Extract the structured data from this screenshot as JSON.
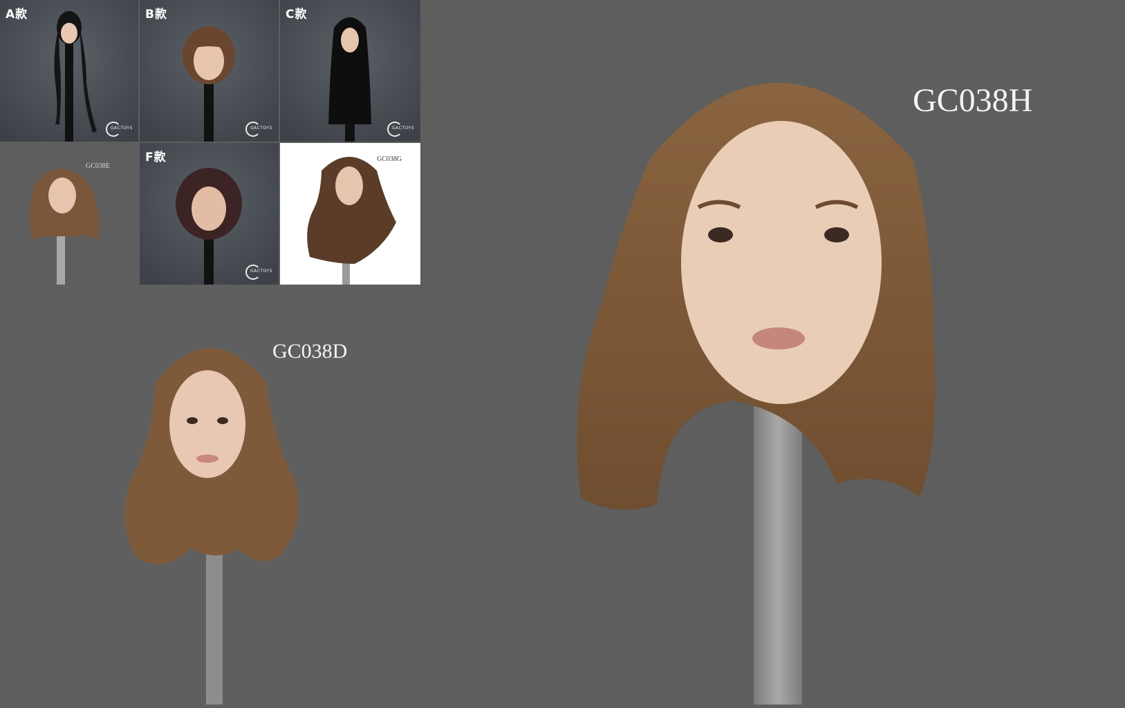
{
  "grid": {
    "tiles": [
      {
        "label": "A款"
      },
      {
        "label": "B款"
      },
      {
        "label": "C款"
      },
      {
        "code": "GC038E"
      },
      {
        "label": "F款"
      },
      {
        "code": "GC038G"
      }
    ],
    "logo_text": "GACTOYS"
  },
  "left_panel": {
    "code": "GC038D"
  },
  "right_panel": {
    "code": "GC038H"
  },
  "colors": {
    "background": "#5e5e5e",
    "tile_background": "#4a4f55",
    "white_tile": "#ffffff",
    "hair_brown": "#8a6440",
    "hair_black": "#111111",
    "skin": "#e6c4ae",
    "stand_gray": "#9a9a9a"
  }
}
